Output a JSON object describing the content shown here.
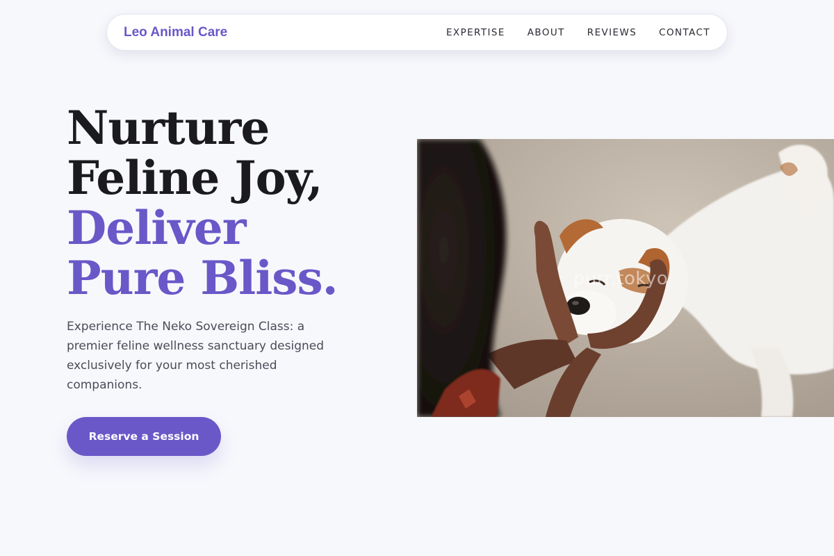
{
  "nav": {
    "brand": "Leo Animal Care",
    "links": [
      {
        "label": "EXPERTISE"
      },
      {
        "label": "ABOUT"
      },
      {
        "label": "REVIEWS"
      },
      {
        "label": "CONTACT"
      }
    ]
  },
  "hero": {
    "headline_line1": "Nurture",
    "headline_line2": "Feline Joy,",
    "headline_line3": "Deliver",
    "headline_line4": "Pure Bliss.",
    "description": "Experience The Neko Sovereign Class: a premier feline wellness sanctuary designed exclusively for your most cherished companions.",
    "cta_label": "Reserve a Session"
  },
  "photo": {
    "watermark": "purr.tokyo",
    "subject": "person-cradling-white-puppy"
  },
  "colors": {
    "accent": "#6a57c8",
    "background": "#f7f8fc",
    "headline": "#1b1b1f",
    "body_text": "#4b4b57"
  }
}
